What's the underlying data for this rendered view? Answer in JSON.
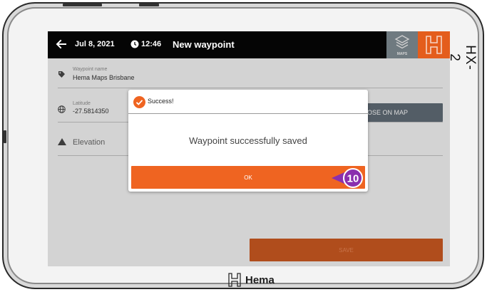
{
  "device": {
    "model": "HX-2",
    "brand": "Hema"
  },
  "topbar": {
    "date": "Jul 8, 2021",
    "time": "12:46",
    "title": "New waypoint",
    "maps_label": "MAPS"
  },
  "form": {
    "waypoint_name_label": "Waypoint name",
    "waypoint_name_value": "Hema Maps Brisbane",
    "latitude_label": "Latitude",
    "latitude_value": "-27.5814350",
    "close_on_map_label": "OSE ON MAP",
    "elevation_label": "Elevation",
    "save_label": "SAVE"
  },
  "dialog": {
    "title": "Success!",
    "message": "Waypoint successfully saved",
    "ok_label": "OK"
  },
  "callout": {
    "number": "10"
  },
  "colors": {
    "accent_orange": "#ef6421",
    "topbar_black": "#050505",
    "callout_purple": "#8a2fae"
  }
}
